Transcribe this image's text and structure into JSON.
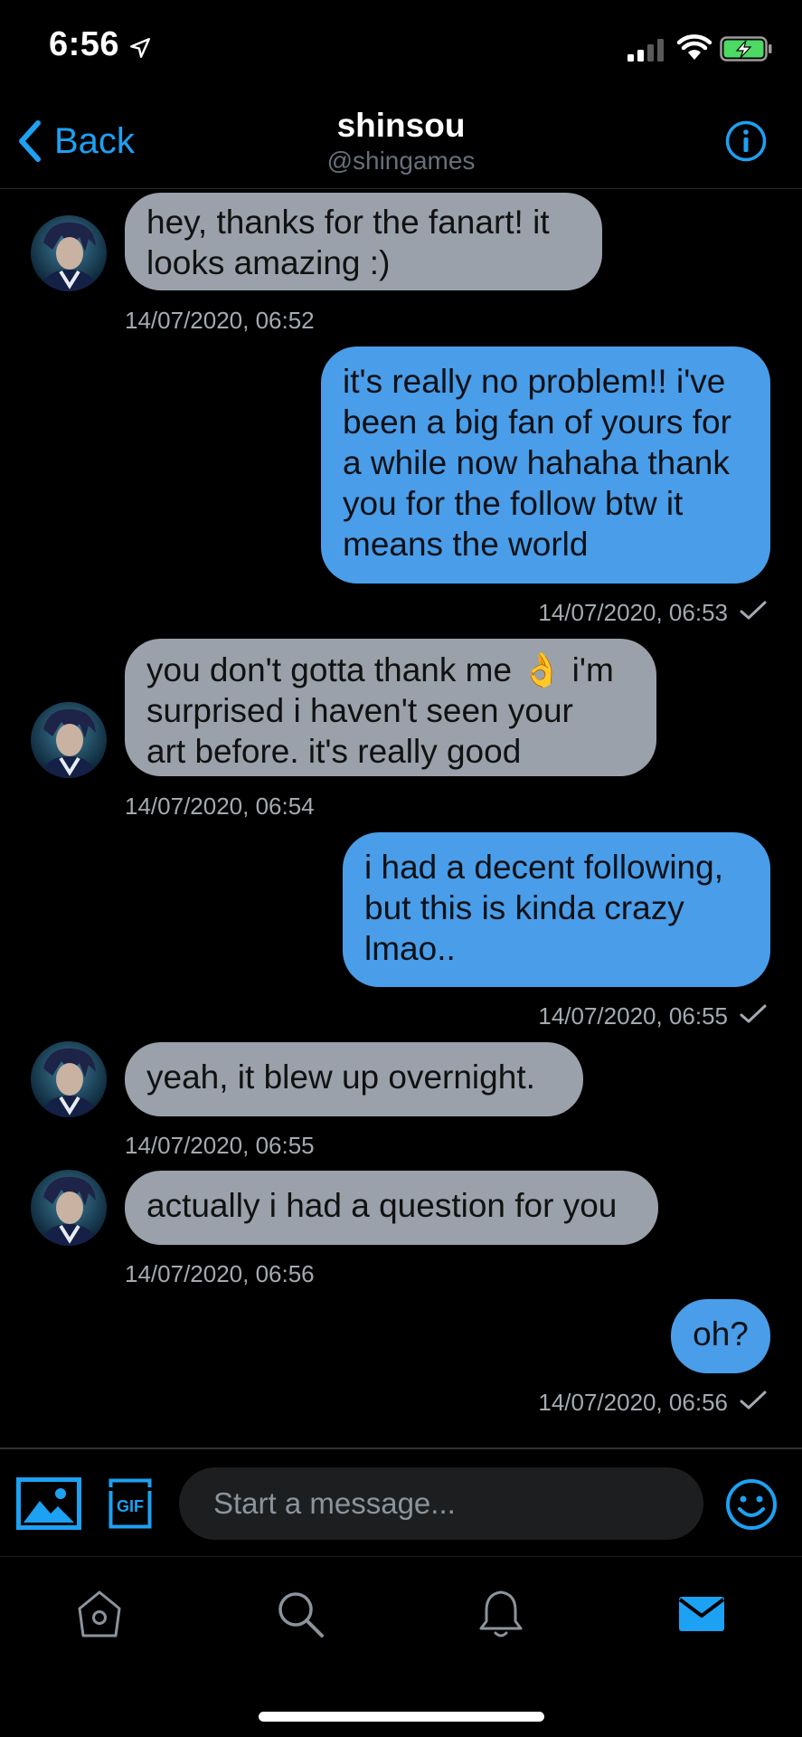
{
  "status_bar": {
    "time": "6:56",
    "icons": [
      "location-arrow-icon",
      "cellular-signal-icon",
      "wifi-icon",
      "battery-charging-icon"
    ]
  },
  "header": {
    "back_label": "Back",
    "name": "shinsou",
    "handle": "@shingames",
    "accent_color": "#1DA1F2"
  },
  "messages": [
    {
      "from": "them",
      "lines": [
        "hey, thanks for the fanart! it",
        "looks amazing :)"
      ],
      "timestamp": "14/07/2020, 06:52"
    },
    {
      "from": "me",
      "lines": [
        "it's really no problem!! i've",
        "been a big fan of yours for",
        "a while now hahaha thank",
        "you for the follow btw it",
        "means the world"
      ],
      "timestamp": "14/07/2020, 06:53",
      "read": true
    },
    {
      "from": "them",
      "lines": [
        "you don't gotta thank me 👌 i'm",
        "surprised i haven't seen your",
        "art before. it's really good"
      ],
      "timestamp": "14/07/2020, 06:54"
    },
    {
      "from": "me",
      "lines": [
        "i had a decent following,",
        "but this is kinda crazy",
        "lmao.."
      ],
      "timestamp": "14/07/2020, 06:55",
      "read": true
    },
    {
      "from": "them",
      "lines": [
        "yeah, it blew up overnight."
      ],
      "timestamp": "14/07/2020, 06:55"
    },
    {
      "from": "them",
      "lines": [
        "actually i had a question for you"
      ],
      "timestamp": "14/07/2020, 06:56"
    },
    {
      "from": "me",
      "lines": [
        "oh?"
      ],
      "timestamp": "14/07/2020, 06:56",
      "read": true
    }
  ],
  "colors": {
    "incoming_bubble": "#9aa1aa",
    "outgoing_bubble": "#4a9de8",
    "background": "#000000"
  },
  "compose": {
    "placeholder": "Start a message...",
    "gif_label": "GIF"
  },
  "tab_bar": {
    "tabs": [
      "home-icon",
      "search-icon",
      "notifications-icon",
      "messages-icon"
    ],
    "active": "messages-icon"
  }
}
